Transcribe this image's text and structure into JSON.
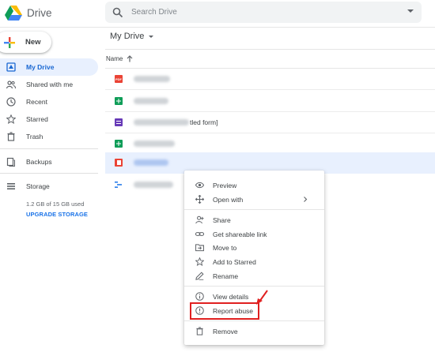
{
  "header": {
    "app_title": "Drive",
    "search_placeholder": "Search Drive"
  },
  "new_button": {
    "label": "New"
  },
  "sidebar": {
    "items": [
      {
        "label": "My Drive",
        "icon": "my-drive-icon",
        "active": true
      },
      {
        "label": "Shared with me",
        "icon": "shared-icon"
      },
      {
        "label": "Recent",
        "icon": "clock-icon"
      },
      {
        "label": "Starred",
        "icon": "star-icon"
      },
      {
        "label": "Trash",
        "icon": "trash-icon"
      },
      {
        "label": "Backups",
        "icon": "backups-icon"
      },
      {
        "label": "Storage",
        "icon": "storage-icon"
      }
    ],
    "storage_usage": "1.2 GB of 15 GB used",
    "upgrade_label": "UPGRADE STORAGE"
  },
  "main": {
    "title": "My Drive",
    "name_column": "Name",
    "files": [
      {
        "type": "pdf",
        "icon_label": "PDF",
        "color": "#ea4335"
      },
      {
        "type": "sheets",
        "color": "#0f9d58"
      },
      {
        "type": "forms",
        "color": "#673ab7",
        "suffix": "tled form]"
      },
      {
        "type": "sheets",
        "color": "#0f9d58"
      },
      {
        "type": "pdf-selected",
        "color": "#ea4335",
        "selected": true
      },
      {
        "type": "sites",
        "color": "#1a73e8"
      }
    ]
  },
  "context_menu": {
    "items": [
      {
        "label": "Preview",
        "icon": "eye-icon"
      },
      {
        "label": "Open with",
        "icon": "move-arrows-icon",
        "has_submenu": true
      },
      {
        "label": "Share",
        "icon": "add-person-icon"
      },
      {
        "label": "Get shareable link",
        "icon": "link-icon"
      },
      {
        "label": "Move to",
        "icon": "folder-move-icon"
      },
      {
        "label": "Add to Starred",
        "icon": "star-icon"
      },
      {
        "label": "Rename",
        "icon": "pencil-icon"
      },
      {
        "label": "View details",
        "icon": "info-icon"
      },
      {
        "label": "Report abuse",
        "icon": "alert-icon",
        "highlighted": true
      },
      {
        "label": "Remove",
        "icon": "trash-icon"
      }
    ]
  },
  "colors": {
    "accent": "#1a73e8",
    "active_bg": "#e8f0fe",
    "highlight": "#e02020"
  }
}
